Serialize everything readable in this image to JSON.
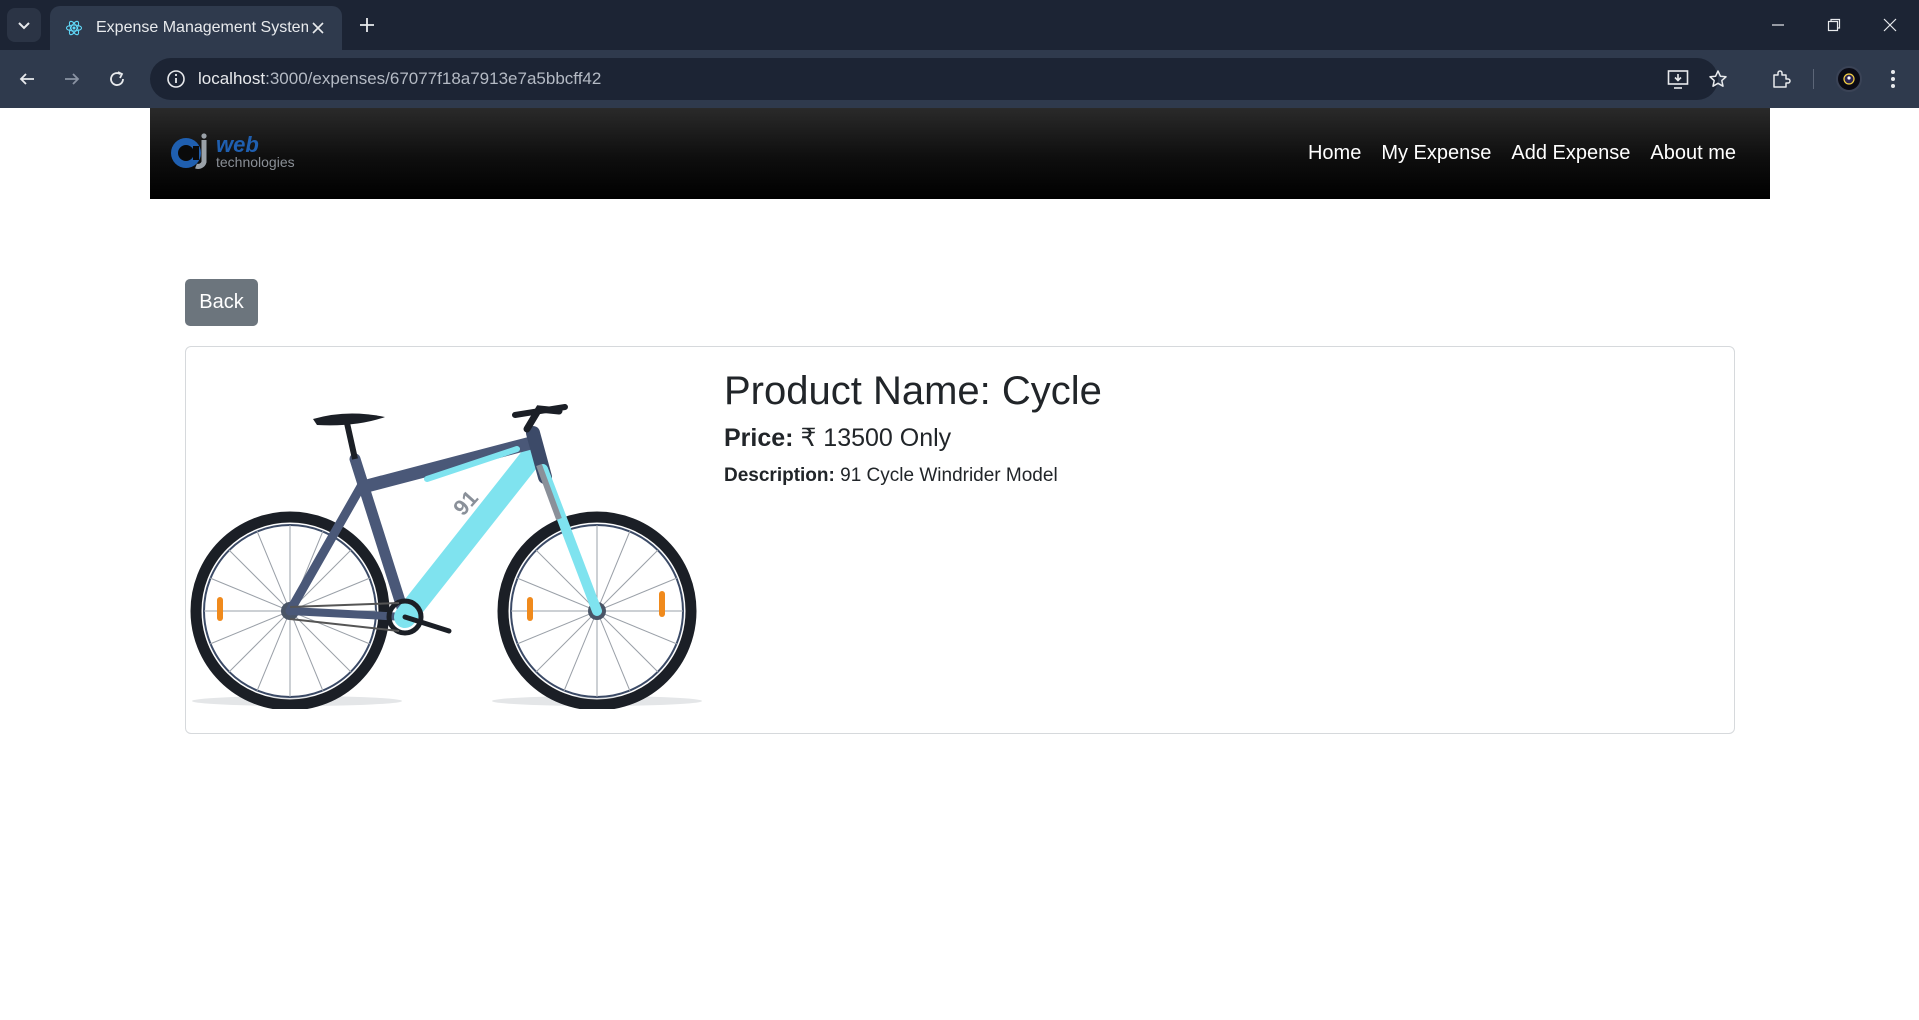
{
  "browser": {
    "tab_title": "Expense Management System",
    "url_host": "localhost",
    "url_path": ":3000/expenses/67077f18a7913e7a5bbcff42"
  },
  "navbar": {
    "logo": {
      "mark": "aj",
      "word": "web",
      "sub": "technologies"
    },
    "links": [
      "Home",
      "My Expense",
      "Add Expense",
      "About me"
    ]
  },
  "page": {
    "back_label": "Back",
    "product": {
      "title": "Product Name: Cycle",
      "price_label": "Price:",
      "price_value": "₹ 13500 Only",
      "description_label": "Description:",
      "description_value": "91 Cycle Windrider Model",
      "image": "bicycle-product-image"
    }
  },
  "colors": {
    "chrome_dark": "#1c2434",
    "chrome_tab": "#2f3a4d",
    "navbar_bg": "#000000",
    "back_button": "#6c757d",
    "bike_frame": "#7fe3ef",
    "bike_frame_dark": "#4a5878"
  }
}
